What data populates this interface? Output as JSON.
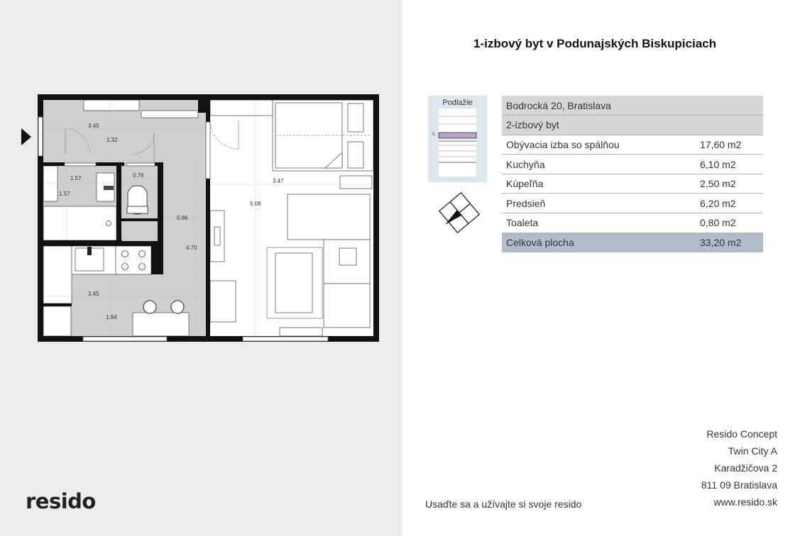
{
  "page": {
    "title": "1-izbový byt v Podunajských Biskupiciach",
    "logo": "resido",
    "tagline": "Usaďte sa a užívajte si svoje resido"
  },
  "floor": {
    "label": "Podlažie",
    "number": "5."
  },
  "info": {
    "address": "Bodrocká 20, Bratislava",
    "type": "2-izbový byt",
    "rooms": [
      {
        "name": "Obývacia izba so spálňou",
        "area": "17,60 m2"
      },
      {
        "name": "Kuchyňa",
        "area": "6,10 m2"
      },
      {
        "name": "Kúpeľňa",
        "area": "2,50 m2"
      },
      {
        "name": "Predsieň",
        "area": "6,20 m2"
      },
      {
        "name": "Toaleta",
        "area": "0,80 m2"
      }
    ],
    "total": {
      "name": "Celková plocha",
      "area": "33,20 m2"
    }
  },
  "plan_dims": {
    "d1": "3.45",
    "d2": "1.32",
    "d3": "1.57",
    "d4": "0.76",
    "d5": "1.57",
    "d6": "0.86",
    "d7": "4.70",
    "d8": "3.45",
    "d9": "1.94",
    "d10": "3.47",
    "d11": "5.08"
  },
  "contact": {
    "company": "Resido Concept",
    "building": "Twin City A",
    "street": "Karadžičova 2",
    "city": "811 09 Bratislava",
    "web": "www.resido.sk"
  },
  "colors": {
    "left_bg": "#ececec",
    "floor_box": "#dde6ee",
    "floor_highlight": "#b9a3c9",
    "table_head": "#d6d6d6",
    "table_total": "#b3bccb",
    "wall": "#111111",
    "floor_tile": "#cfcfcf"
  },
  "icons": {
    "entry": "entry-arrow-icon",
    "compass": "compass-icon"
  }
}
